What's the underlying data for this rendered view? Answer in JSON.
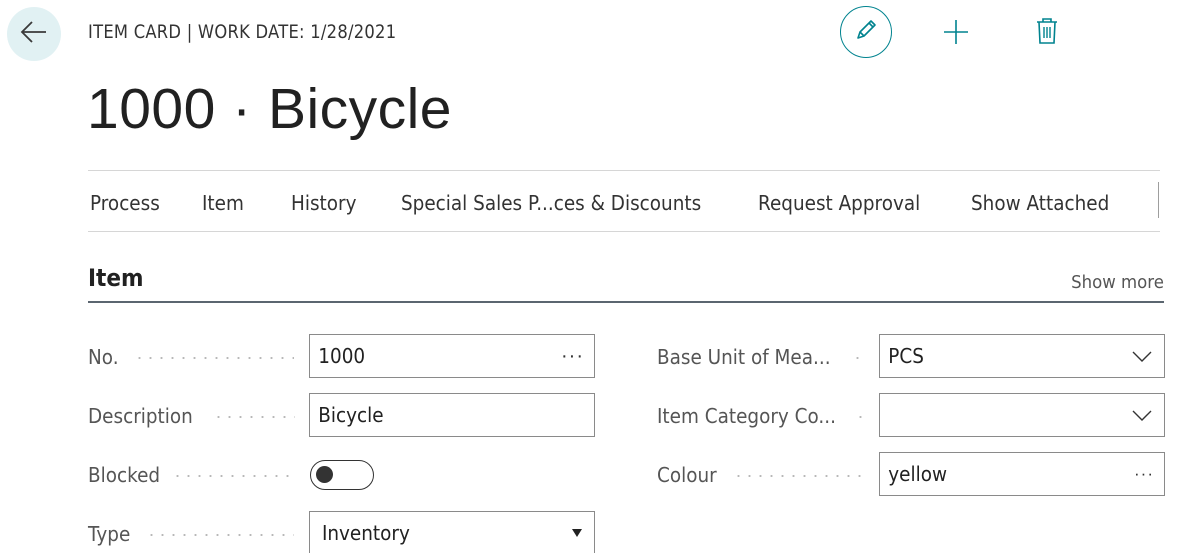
{
  "header": {
    "caption": "ITEM CARD | WORK DATE: 1/28/2021",
    "title": "1000 · Bicycle",
    "back_icon": "arrow-left-icon",
    "edit_icon": "pencil-icon",
    "new_icon": "plus-icon",
    "delete_icon": "trash-icon"
  },
  "action_bar": {
    "items": [
      "Process",
      "Item",
      "History",
      "Special Sales P...ces & Discounts",
      "Request Approval",
      "Show Attached"
    ]
  },
  "section": {
    "title": "Item",
    "show_more": "Show more"
  },
  "fields_left": {
    "no": {
      "label": "No.",
      "value": "1000"
    },
    "description": {
      "label": "Description",
      "value": "Bicycle"
    },
    "blocked": {
      "label": "Blocked",
      "value": false
    },
    "type": {
      "label": "Type",
      "value": "Inventory"
    }
  },
  "fields_right": {
    "base_unit": {
      "label": "Base Unit of Mea...",
      "value": "PCS"
    },
    "item_category": {
      "label": "Item Category Co...",
      "value": ""
    },
    "colour": {
      "label": "Colour",
      "value": "yellow"
    }
  },
  "colors": {
    "accent": "#00838f",
    "back_button_bg": "#e1f1f3",
    "section_rule": "#5b6670"
  }
}
